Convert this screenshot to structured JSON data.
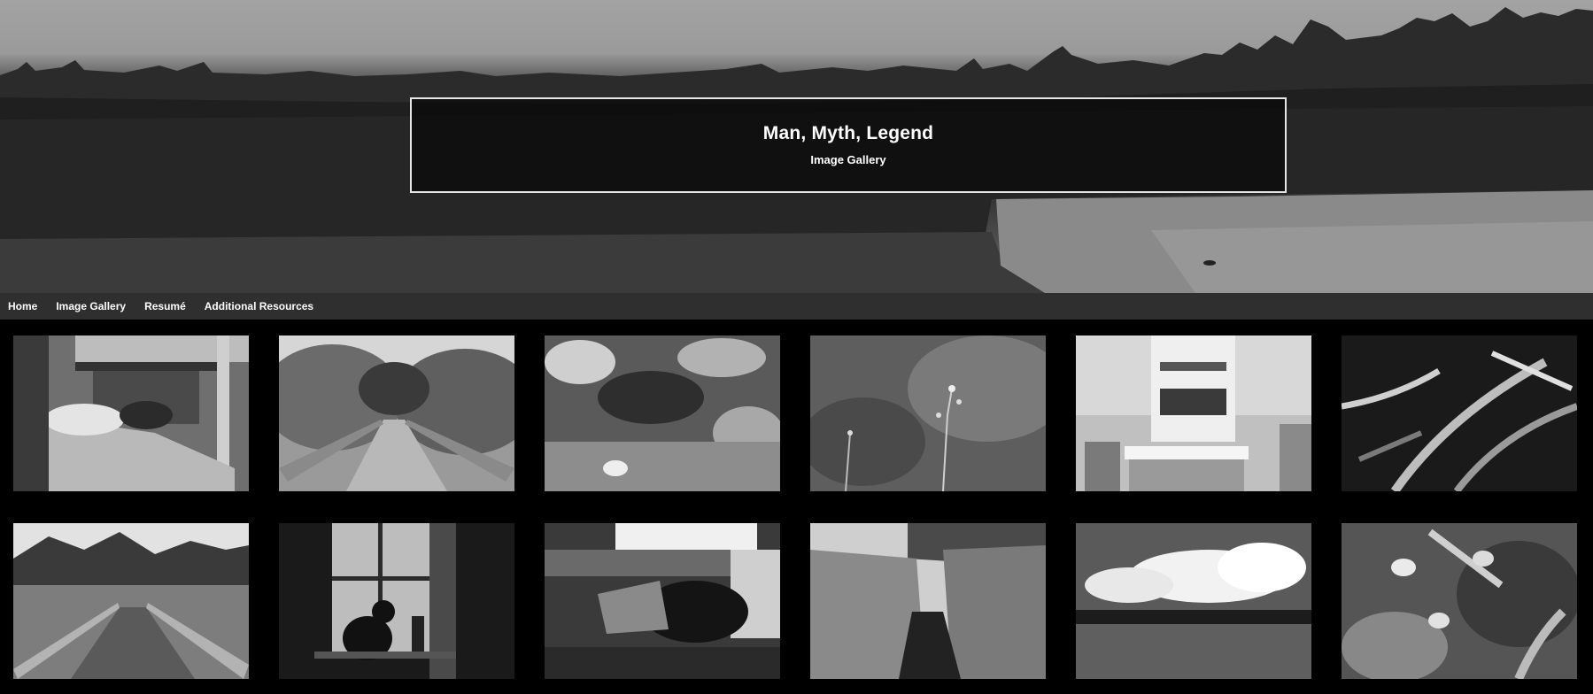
{
  "hero": {
    "title": "Man, Myth, Legend",
    "subtitle": "Image Gallery"
  },
  "nav": {
    "items": [
      {
        "label": "Home"
      },
      {
        "label": "Image Gallery"
      },
      {
        "label": "Resumé"
      },
      {
        "label": "Additional Resources"
      }
    ]
  },
  "gallery": {
    "rows": 2,
    "columns": 6,
    "photos": [
      {
        "subject": "bunk-bed-with-dog"
      },
      {
        "subject": "forest-boardwalk"
      },
      {
        "subject": "plants-closeup"
      },
      {
        "subject": "small-flowers-blurred"
      },
      {
        "subject": "kitchen-with-stereo"
      },
      {
        "subject": "fern-leaves"
      },
      {
        "subject": "marsh-boardwalk"
      },
      {
        "subject": "cat-in-window"
      },
      {
        "subject": "cat-on-blanket"
      },
      {
        "subject": "reeds-and-stream"
      },
      {
        "subject": "clouds-over-field"
      },
      {
        "subject": "wildflowers"
      }
    ]
  }
}
